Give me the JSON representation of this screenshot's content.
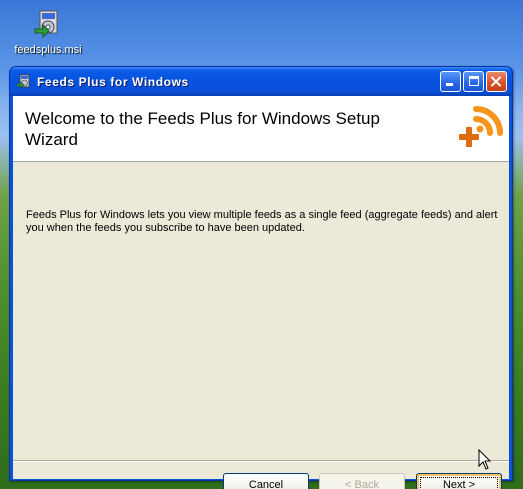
{
  "desktop": {
    "icon_label": "feedsplus.msi",
    "icon_name": "msi-installer-icon"
  },
  "window": {
    "title": "Feeds Plus for Windows",
    "title_icon": "installer-icon",
    "controls": {
      "minimize": "minimize-icon",
      "maximize": "maximize-icon",
      "close": "close-icon"
    }
  },
  "banner": {
    "title": "Welcome to the Feeds Plus for Windows Setup Wizard",
    "logo": "feeds-plus-logo-icon",
    "logo_colors": {
      "orange": "#f7941d",
      "orange_dark": "#e06a0e"
    }
  },
  "body": {
    "description": "Feeds Plus for Windows lets you view multiple feeds as a single feed (aggregate feeds) and alert you when the feeds you subscribe to have been updated."
  },
  "buttons": {
    "cancel": "Cancel",
    "back": "< Back",
    "next": "Next >"
  },
  "colors": {
    "titlebar": "#0a53d8",
    "dialog_bg": "#ece9d8",
    "button_border": "#003c74"
  }
}
